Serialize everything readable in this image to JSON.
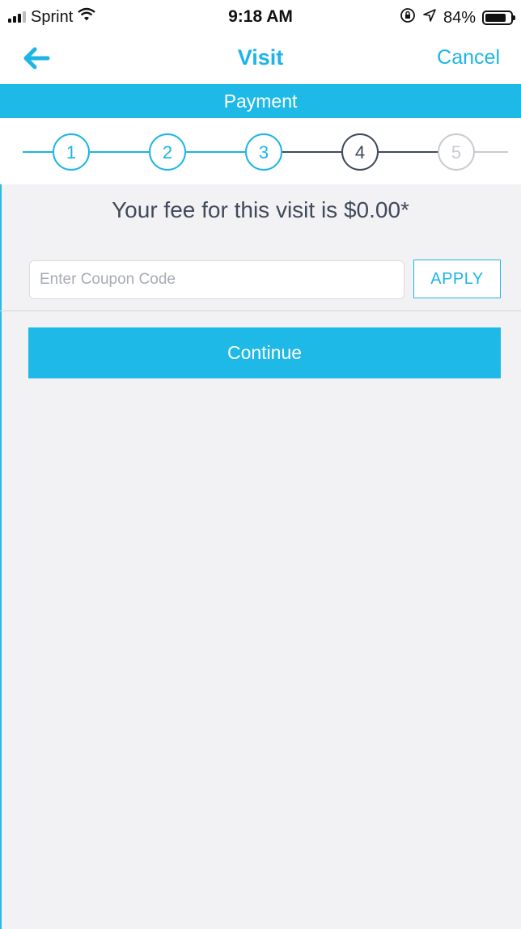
{
  "status_bar": {
    "carrier": "Sprint",
    "time": "9:18 AM",
    "battery_percent": "84%",
    "battery_level": 0.84,
    "icons": [
      "signal-icon",
      "wifi-icon",
      "orientation-lock-icon",
      "location-icon",
      "battery-icon"
    ]
  },
  "nav": {
    "back_icon": "back-arrow-icon",
    "title": "Visit",
    "cancel_label": "Cancel"
  },
  "section": {
    "title": "Payment"
  },
  "stepper": {
    "steps": [
      "1",
      "2",
      "3",
      "4",
      "5"
    ],
    "current_step": 4,
    "colors": {
      "completed": "#1cb5e6",
      "current": "#3f4a5a",
      "upcoming": "#c9cbd1"
    }
  },
  "fee": {
    "text": "Your fee for this visit is $0.00*"
  },
  "coupon": {
    "placeholder": "Enter Coupon Code",
    "value": "",
    "apply_label": "APPLY"
  },
  "continue_label": "Continue",
  "colors": {
    "accent": "#1cb5e6",
    "background": "#f2f2f4",
    "text_dark": "#3f4a5a"
  }
}
